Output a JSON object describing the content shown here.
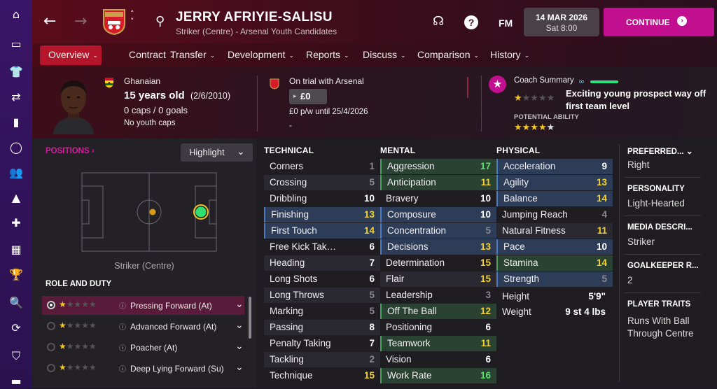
{
  "header": {
    "player_name": "JERRY AFRIYIE-SALISU",
    "subtitle": "Striker (Centre) - Arsenal Youth Candidates",
    "date": "14 MAR 2026",
    "time": "Sat 8:00",
    "fm_label": "FM",
    "continue_label": "CONTINUE",
    "club_badge_text": "Arsenal"
  },
  "nav": {
    "tabs": [
      {
        "label": "Overview"
      },
      {
        "label": "Contract"
      },
      {
        "label": "Transfer"
      },
      {
        "label": "Development"
      },
      {
        "label": "Reports"
      },
      {
        "label": "Discuss"
      },
      {
        "label": "Comparison"
      },
      {
        "label": "History"
      }
    ]
  },
  "profile": {
    "nationality": "Ghanaian",
    "age": "15 years old",
    "dob": "(2/6/2010)",
    "caps": "0 caps / 0 goals",
    "youth_caps": "No youth caps"
  },
  "contract": {
    "status": "On trial with Arsenal",
    "value": "£0",
    "wage": "£0 p/w until 25/4/2026",
    "extra": "-"
  },
  "coach": {
    "title": "Coach Summary",
    "summary": "Exciting young prospect way off first team level",
    "potential_label": "POTENTIAL ABILITY",
    "current_stars": 1,
    "potential_stars": 4.5
  },
  "positions": {
    "label": "POSITIONS",
    "highlight_label": "Highlight",
    "position_text": "Striker (Centre)"
  },
  "role_duty": {
    "label": "ROLE AND DUTY",
    "roles": [
      {
        "name": "Pressing Forward (At)",
        "stars": 1,
        "selected": true
      },
      {
        "name": "Advanced Forward (At)",
        "stars": 1,
        "selected": false
      },
      {
        "name": "Poacher (At)",
        "stars": 1,
        "selected": false
      },
      {
        "name": "Deep Lying Forward (Su)",
        "stars": 1,
        "selected": false
      }
    ]
  },
  "technical": {
    "title": "TECHNICAL",
    "attributes": [
      {
        "name": "Corners",
        "value": "1",
        "style": "dark",
        "tone": "grey"
      },
      {
        "name": "Crossing",
        "value": "5",
        "style": "alt",
        "tone": "grey"
      },
      {
        "name": "Dribbling",
        "value": "10",
        "style": "dark",
        "tone": "white"
      },
      {
        "name": "Finishing",
        "value": "13",
        "style": "blue",
        "tone": "yellow"
      },
      {
        "name": "First Touch",
        "value": "14",
        "style": "blue",
        "tone": "yellow"
      },
      {
        "name": "Free Kick Tak…",
        "value": "6",
        "style": "dark",
        "tone": "white"
      },
      {
        "name": "Heading",
        "value": "7",
        "style": "alt",
        "tone": "white"
      },
      {
        "name": "Long Shots",
        "value": "6",
        "style": "dark",
        "tone": "white"
      },
      {
        "name": "Long Throws",
        "value": "5",
        "style": "alt",
        "tone": "grey"
      },
      {
        "name": "Marking",
        "value": "5",
        "style": "dark",
        "tone": "grey"
      },
      {
        "name": "Passing",
        "value": "8",
        "style": "alt",
        "tone": "white"
      },
      {
        "name": "Penalty Taking",
        "value": "7",
        "style": "dark",
        "tone": "white"
      },
      {
        "name": "Tackling",
        "value": "2",
        "style": "alt",
        "tone": "grey"
      },
      {
        "name": "Technique",
        "value": "15",
        "style": "dark",
        "tone": "yellow"
      }
    ]
  },
  "mental": {
    "title": "MENTAL",
    "attributes": [
      {
        "name": "Aggression",
        "value": "17",
        "style": "green",
        "tone": "green"
      },
      {
        "name": "Anticipation",
        "value": "11",
        "style": "green",
        "tone": "yellow"
      },
      {
        "name": "Bravery",
        "value": "10",
        "style": "dark",
        "tone": "white"
      },
      {
        "name": "Composure",
        "value": "10",
        "style": "blue",
        "tone": "white"
      },
      {
        "name": "Concentration",
        "value": "5",
        "style": "blue",
        "tone": "grey"
      },
      {
        "name": "Decisions",
        "value": "13",
        "style": "blue",
        "tone": "yellow"
      },
      {
        "name": "Determination",
        "value": "15",
        "style": "dark",
        "tone": "yellow"
      },
      {
        "name": "Flair",
        "value": "15",
        "style": "alt",
        "tone": "yellow"
      },
      {
        "name": "Leadership",
        "value": "3",
        "style": "dark",
        "tone": "grey"
      },
      {
        "name": "Off The Ball",
        "value": "12",
        "style": "green",
        "tone": "yellow"
      },
      {
        "name": "Positioning",
        "value": "6",
        "style": "dark",
        "tone": "white"
      },
      {
        "name": "Teamwork",
        "value": "11",
        "style": "green",
        "tone": "yellow"
      },
      {
        "name": "Vision",
        "value": "6",
        "style": "dark",
        "tone": "white"
      },
      {
        "name": "Work Rate",
        "value": "16",
        "style": "green",
        "tone": "green"
      }
    ]
  },
  "physical": {
    "title": "PHYSICAL",
    "attributes": [
      {
        "name": "Acceleration",
        "value": "9",
        "style": "blue",
        "tone": "white"
      },
      {
        "name": "Agility",
        "value": "13",
        "style": "blue",
        "tone": "yellow"
      },
      {
        "name": "Balance",
        "value": "14",
        "style": "blue",
        "tone": "yellow"
      },
      {
        "name": "Jumping Reach",
        "value": "4",
        "style": "dark",
        "tone": "grey"
      },
      {
        "name": "Natural Fitness",
        "value": "11",
        "style": "alt",
        "tone": "yellow"
      },
      {
        "name": "Pace",
        "value": "10",
        "style": "blue",
        "tone": "white"
      },
      {
        "name": "Stamina",
        "value": "14",
        "style": "green",
        "tone": "yellow"
      },
      {
        "name": "Strength",
        "value": "5",
        "style": "blue",
        "tone": "grey"
      }
    ],
    "height_label": "Height",
    "height_value": "5'9\"",
    "weight_label": "Weight",
    "weight_value": "9 st 4 lbs"
  },
  "side": {
    "preferred_label": "PREFERRED...",
    "preferred_value": "Right",
    "personality_label": "PERSONALITY",
    "personality_value": "Light-Hearted",
    "media_label": "MEDIA DESCRI...",
    "media_value": "Striker",
    "gk_label": "GOALKEEPER R...",
    "gk_value": "2",
    "traits_label": "PLAYER TRAITS",
    "traits_value": "Runs With Ball Through Centre"
  },
  "colors": {
    "accent": "#c20f8f",
    "yellow": "#f2d22b",
    "green": "#5ee06a",
    "sidebar": "#3a1466"
  }
}
